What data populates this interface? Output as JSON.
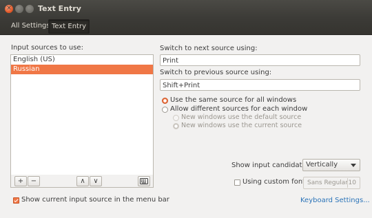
{
  "window": {
    "title": "Text Entry"
  },
  "toolbar": {
    "all_settings": "All Settings",
    "current": "Text Entry"
  },
  "sources": {
    "heading": "Input sources to use:",
    "items": [
      "English (US)",
      "Russian"
    ],
    "selected_index": 1
  },
  "switch_next": {
    "label": "Switch to next source using:",
    "value": "Print"
  },
  "switch_prev": {
    "label": "Switch to previous source using:",
    "value": "Shift+Print"
  },
  "radios": {
    "same": "Use the same source for all windows",
    "different": "Allow different sources for each window",
    "new_default": "New windows use the default source",
    "new_current": "New windows use the current source"
  },
  "candidates": {
    "label": "Show input candidates:",
    "value": "Vertically"
  },
  "custom_font": {
    "label": "Using custom font:",
    "font": "Sans Regular",
    "size": "10"
  },
  "menu_bar_check": "Show current input source in the menu bar",
  "keyboard_link": "Keyboard Settings...",
  "icons": {
    "add": "+",
    "remove": "−",
    "up": "∧",
    "down": "∨"
  },
  "colors": {
    "accent": "#f07746",
    "titlebar": "#3c3b37",
    "link": "#2a73b8"
  }
}
